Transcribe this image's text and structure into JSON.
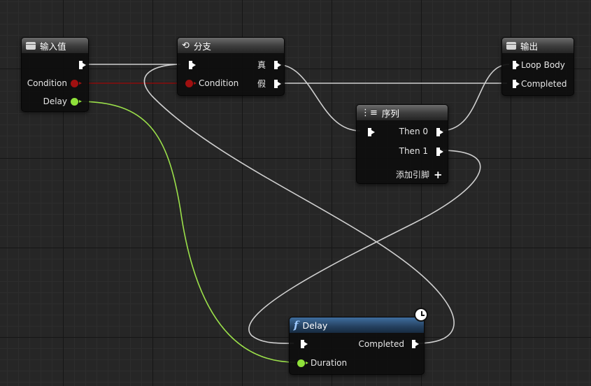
{
  "graph": {
    "wire_colors": {
      "exec": "#cfcfcf",
      "bool": "#8a0b0b",
      "float": "#9be04a"
    }
  },
  "nodes": {
    "input": {
      "title": "输入值",
      "icon": "struct-box-icon",
      "header_color": "#4a4a4a",
      "pins": {
        "condition": "Condition",
        "delay": "Delay"
      }
    },
    "branch": {
      "title": "分支",
      "icon": "branch-icon",
      "header_color": "#4a4a4a",
      "pins": {
        "condition": "Condition",
        "true": "真",
        "false": "假"
      }
    },
    "output": {
      "title": "输出",
      "icon": "struct-box-icon",
      "header_color": "#4a4a4a",
      "pins": {
        "loop_body": "Loop Body",
        "completed": "Completed"
      }
    },
    "sequence": {
      "title": "序列",
      "icon": "sequence-icon",
      "header_color": "#4a4a4a",
      "pins": {
        "then0": "Then 0",
        "then1": "Then 1",
        "add_pin": "添加引脚"
      }
    },
    "delay": {
      "title": "Delay",
      "icon": "function-icon",
      "header_color": "#2f5680",
      "pins": {
        "completed": "Completed",
        "duration": "Duration"
      },
      "badge_icon": "clock-icon"
    }
  }
}
